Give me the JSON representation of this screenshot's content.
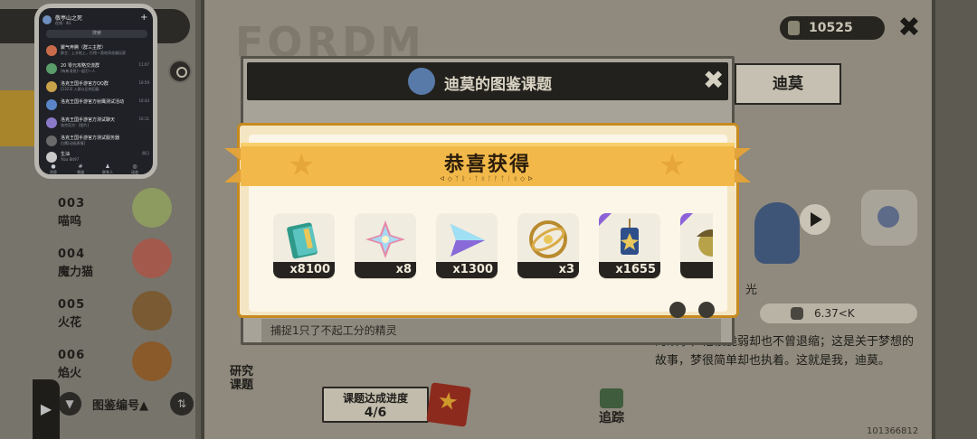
{
  "currency": {
    "amount": "10525",
    "icon": "energy-cell-icon"
  },
  "character": {
    "name": "迪莫",
    "element": "光",
    "weight": "6.37<K",
    "description": "的故事，他很脆弱却也不曾退缩；这是关于梦想的故事，梦很简单却也执着。这就是我，迪莫。"
  },
  "list": {
    "entries": [
      {
        "num": "003",
        "name": "喵呜"
      },
      {
        "num": "004",
        "name": "魔力猫"
      },
      {
        "num": "005",
        "name": "火花"
      },
      {
        "num": "006",
        "name": "焰火"
      }
    ],
    "sort_label": "图鉴编号▲"
  },
  "research": {
    "label_line1": "研究",
    "label_line2": "课题"
  },
  "progress": {
    "label": "课题达成进度",
    "value": "4/6"
  },
  "track": {
    "label": "追踪"
  },
  "info_dialog": {
    "title": "迪莫的图鉴课题",
    "footer_text": "捕捉1只了不起工分的精灵"
  },
  "reward": {
    "title": "恭喜获得",
    "subtitle": "ᐊ◇ᛉᚱᚲᛏᛟᛚᚨᛏᛁᛟ◇ᐅ",
    "items": [
      {
        "icon": "ticket-icon",
        "qty": "x8100",
        "rare": false
      },
      {
        "icon": "crystal-flower-icon",
        "qty": "x8",
        "rare": false
      },
      {
        "icon": "prism-gem-icon",
        "qty": "x1300",
        "rare": false
      },
      {
        "icon": "astrolabe-icon",
        "qty": "x3",
        "rare": false
      },
      {
        "icon": "charm-pendant-icon",
        "qty": "x1655",
        "rare": true
      },
      {
        "icon": "acorn-icon",
        "qty": "",
        "rare": true
      }
    ]
  },
  "uid": "101366812",
  "phone": {
    "user": "敬亭山之死",
    "status": "在线 · 4G",
    "search": "搜索",
    "chats": [
      {
        "title": "聚气奔腾（群三主群）",
        "preview": "群主：上头啦上，打榜一直吃同花顺玩家",
        "time": "",
        "color": "#c96b4a"
      },
      {
        "title": "20 零元攻略交流群",
        "preview": "[有新消息]一起打~人",
        "time": "11:07",
        "color": "#5a9c6a"
      },
      {
        "title": "洛克王国手游官方QQ群",
        "preview": "[2323] 入群以后的回复",
        "time": "10:59",
        "color": "#c9a24a"
      },
      {
        "title": "洛克王国手游官方射鹰测试活动",
        "preview": "",
        "time": "10:43",
        "color": "#5a86c9"
      },
      {
        "title": "洛克王国手游官方测试聊天",
        "preview": "洛克官方：[图片]",
        "time": "10:11",
        "color": "#8a7ac9"
      },
      {
        "title": "洛克王国手游官方测试服务器",
        "preview": "白鹰[动画表情]",
        "time": "",
        "color": "#6a6a6a"
      },
      {
        "title": "生油",
        "preview": "Yiba Blt97",
        "time": "周日",
        "color": "#c9c9c9"
      }
    ],
    "nav": [
      {
        "icon": "chat-icon",
        "label": "消息"
      },
      {
        "icon": "channel-icon",
        "label": "频道"
      },
      {
        "icon": "contacts-icon",
        "label": "联系人"
      },
      {
        "icon": "moments-icon",
        "label": "动态"
      }
    ]
  }
}
